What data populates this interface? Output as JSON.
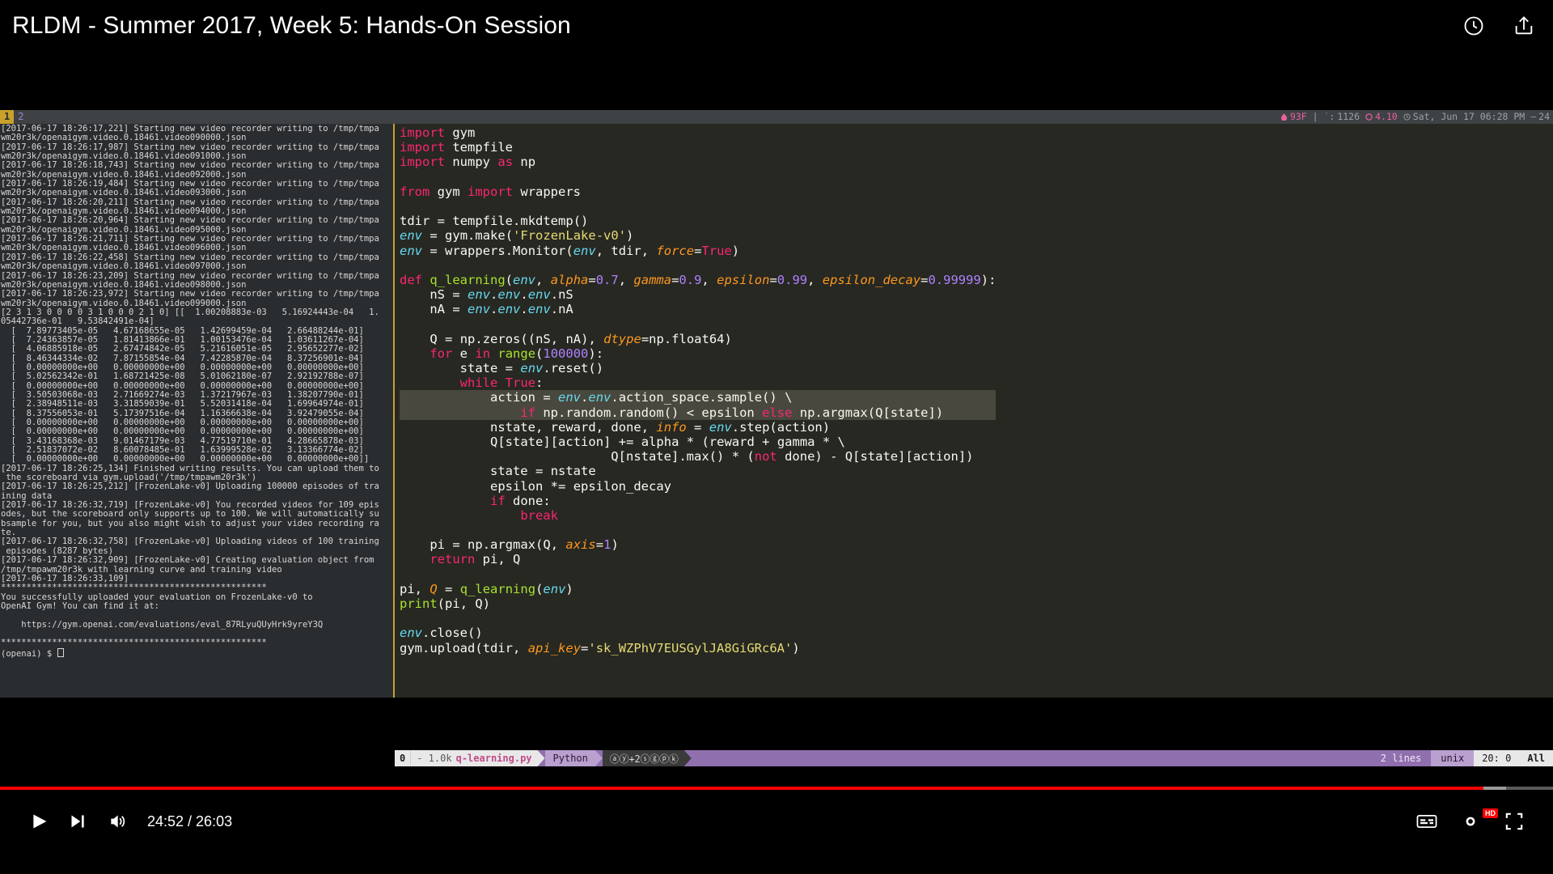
{
  "video": {
    "title": "RLDM - Summer 2017, Week 5: Hands-On Session",
    "current_time": "24:52",
    "duration": "26:03",
    "time_display": "24:52 / 26:03",
    "progress_percent": 95.5,
    "buffer_percent": 97.0,
    "accent_color": "#ff0000",
    "header_icons": [
      {
        "name": "watch-later-icon",
        "label": "Watch later"
      },
      {
        "name": "share-icon",
        "label": "Share"
      }
    ],
    "controls": {
      "play_label": "Play",
      "next_label": "Next",
      "volume_label": "Mute",
      "captions_label": "Subtitles/closed captions",
      "settings_label": "Settings",
      "quality_badge": "HD",
      "fullscreen_label": "Full screen"
    }
  },
  "tmux": {
    "windows": [
      {
        "index": "1",
        "active": true
      },
      {
        "index": "2",
        "active": false
      }
    ],
    "status_right": {
      "temperature": "93F",
      "memory": "1126",
      "load": "4.10",
      "clock": "Sat, Jun 17 06:28 PM",
      "battery": "24"
    }
  },
  "terminal": {
    "prompt": "(openai) $ ",
    "lines": [
      "[2017-06-17 18:26:17,221] Starting new video recorder writing to /tmp/tmpa",
      "wm20r3k/openaigym.video.0.18461.video090000.json",
      "[2017-06-17 18:26:17,987] Starting new video recorder writing to /tmp/tmpa",
      "wm20r3k/openaigym.video.0.18461.video091000.json",
      "[2017-06-17 18:26:18,743] Starting new video recorder writing to /tmp/tmpa",
      "wm20r3k/openaigym.video.0.18461.video092000.json",
      "[2017-06-17 18:26:19,484] Starting new video recorder writing to /tmp/tmpa",
      "wm20r3k/openaigym.video.0.18461.video093000.json",
      "[2017-06-17 18:26:20,211] Starting new video recorder writing to /tmp/tmpa",
      "wm20r3k/openaigym.video.0.18461.video094000.json",
      "[2017-06-17 18:26:20,964] Starting new video recorder writing to /tmp/tmpa",
      "wm20r3k/openaigym.video.0.18461.video095000.json",
      "[2017-06-17 18:26:21,711] Starting new video recorder writing to /tmp/tmpa",
      "wm20r3k/openaigym.video.0.18461.video096000.json",
      "[2017-06-17 18:26:22,458] Starting new video recorder writing to /tmp/tmpa",
      "wm20r3k/openaigym.video.0.18461.video097000.json",
      "[2017-06-17 18:26:23,209] Starting new video recorder writing to /tmp/tmpa",
      "wm20r3k/openaigym.video.0.18461.video098000.json",
      "[2017-06-17 18:26:23,972] Starting new video recorder writing to /tmp/tmpa",
      "wm20r3k/openaigym.video.0.18461.video099000.json",
      "[2 3 1 3 0 0 0 0 3 1 0 0 0 2 1 0] [[  1.00208883e-03   5.16924443e-04   1.",
      "05442736e-01   9.53842491e-04]",
      "  [  7.89773405e-05   4.67168655e-05   1.42699459e-04   2.66488244e-01]",
      "  [  7.24363857e-05   1.81413866e-01   1.00153476e-04   1.03611267e-04]",
      "  [  4.06885918e-05   2.67474842e-05   5.21616051e-05   2.95652277e-02]",
      "  [  8.46344334e-02   7.87155854e-04   7.42285870e-04   8.37256901e-04]",
      "  [  0.00000000e+00   0.00000000e+00   0.00000000e+00   0.00000000e+00]",
      "  [  5.02562342e-01   1.68721425e-08   5.01062180e-07   2.92192788e-07]",
      "  [  0.00000000e+00   0.00000000e+00   0.00000000e+00   0.00000000e+00]",
      "  [  3.50503068e-03   2.71669274e-03   1.37217967e-03   1.38207790e-01]",
      "  [  2.38948511e-03   3.31859039e-01   5.52031418e-04   1.69964974e-01]",
      "  [  8.37556053e-01   5.17397516e-04   1.16366638e-04   3.92479055e-04]",
      "  [  0.00000000e+00   0.00000000e+00   0.00000000e+00   0.00000000e+00]",
      "  [  0.00000000e+00   0.00000000e+00   0.00000000e+00   0.00000000e+00]",
      "  [  3.43168368e-03   9.01467179e-03   4.77519710e-01   4.28665878e-03]",
      "  [  2.51837072e-02   8.60078485e-01   1.63999528e-02   3.13366774e-02]",
      "  [  0.00000000e+00   0.00000000e+00   0.00000000e+00   0.00000000e+00]]",
      "[2017-06-17 18:26:25,134] Finished writing results. You can upload them to",
      " the scoreboard via gym.upload('/tmp/tmpawm20r3k')",
      "[2017-06-17 18:26:25,212] [FrozenLake-v0] Uploading 100000 episodes of tra",
      "ining data",
      "[2017-06-17 18:26:32,719] [FrozenLake-v0] You recorded videos for 109 epis",
      "odes, but the scoreboard only supports up to 100. We will automatically su",
      "bsample for you, but you also might wish to adjust your video recording ra",
      "te.",
      "[2017-06-17 18:26:32,758] [FrozenLake-v0] Uploading videos of 100 training",
      " episodes (8287 bytes)",
      "[2017-06-17 18:26:32,909] [FrozenLake-v0] Creating evaluation object from ",
      "/tmp/tmpawm20r3k with learning curve and training video",
      "[2017-06-17 18:26:33,109]",
      "****************************************************",
      "You successfully uploaded your evaluation on FrozenLake-v0 to",
      "OpenAI Gym! You can find it at:",
      "",
      "    https://gym.openai.com/evaluations/eval_87RLyuQUyHrk9yreY3Q",
      "",
      "****************************************************"
    ]
  },
  "editor": {
    "filename": "q-learning.py",
    "language": "Python",
    "mode": "0",
    "filesize": "- 1.0k",
    "marks": "ⓐⓨ+2ⓢⓖⓟⓚ",
    "lines_label": "2 lines",
    "encoding": "unix",
    "position": "20: 0",
    "percent": "All",
    "code_lines": [
      "import gym",
      "import tempfile",
      "import numpy as np",
      "",
      "from gym import wrappers",
      "",
      "tdir = tempfile.mkdtemp()",
      "env = gym.make('FrozenLake-v0')",
      "env = wrappers.Monitor(env, tdir, force=True)",
      "",
      "def q_learning(env, alpha=0.7, gamma=0.9, epsilon=0.99, epsilon_decay=0.99999):",
      "    nS = env.env.env.nS",
      "    nA = env.env.env.nA",
      "",
      "    Q = np.zeros((nS, nA), dtype=np.float64)",
      "    for e in range(100000):",
      "        state = env.reset()",
      "        while True:",
      "            action = env.env.action_space.sample() \\",
      "                if np.random.random() < epsilon else np.argmax(Q[state])",
      "            nstate, reward, done, info = env.step(action)",
      "            Q[state][action] += alpha * (reward + gamma * \\",
      "                            Q[nstate].max() * (not done) - Q[state][action])",
      "            state = nstate",
      "            epsilon *= epsilon_decay",
      "            if done:",
      "                break",
      "",
      "    pi = np.argmax(Q, axis=1)",
      "    return pi, Q",
      "",
      "pi, Q = q_learning(env)",
      "print(pi, Q)",
      "",
      "env.close()",
      "gym.upload(tdir, api_key='sk_WZPhV7EUSGylJA8GiGRc6A')"
    ]
  }
}
